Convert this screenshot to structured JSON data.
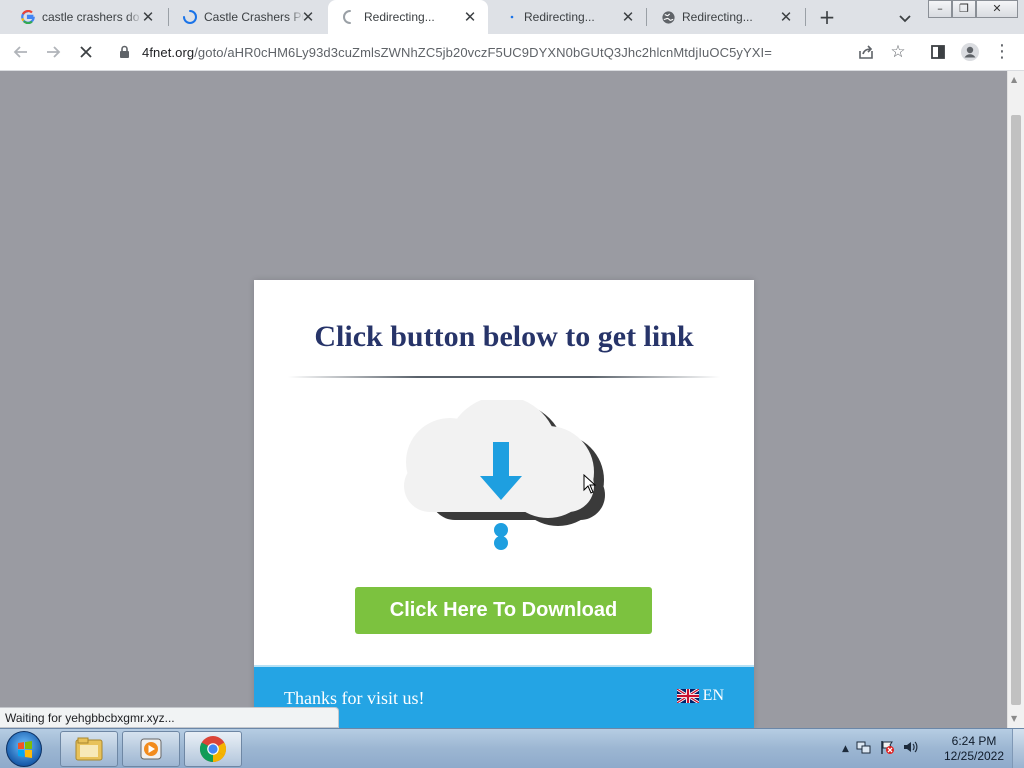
{
  "browser": {
    "tabs": [
      {
        "title": "castle crashers do",
        "favicon": "google-icon",
        "active": false
      },
      {
        "title": "Castle Crashers PC",
        "favicon": "loading-spinner-icon",
        "active": false
      },
      {
        "title": "Redirecting...",
        "favicon": "loading-spinner-icon",
        "active": true
      },
      {
        "title": "Redirecting...",
        "favicon": "dot-icon",
        "active": false
      },
      {
        "title": "Redirecting...",
        "favicon": "globe-icon",
        "active": false
      }
    ],
    "new_tab_icon": "plus-icon",
    "tab_search_icon": "chevron-down-icon",
    "window_controls": [
      "minimize-icon",
      "restore-icon",
      "close-icon"
    ],
    "address_bar": {
      "host": "4fnet.org",
      "path": "/goto/aHR0cHM6Ly93d3cuZmlsZWNhZC5jb20vczF5UC9DYXN0bGUtQ3Jhc2hlcnMtdjIuOC5yYXI="
    },
    "toolbar_icons": [
      "back-arrow-icon",
      "forward-arrow-icon",
      "stop-loading-icon",
      "lock-icon",
      "share-icon",
      "star-icon",
      "side-panel-icon",
      "profile-icon",
      "menu-icon"
    ]
  },
  "modal": {
    "title": "Click button below to get link",
    "download_button": "Click Here To Download",
    "footer_text": "Thanks for visit us!",
    "language": "EN",
    "colors": {
      "title": "#273469",
      "button": "#7cc23f",
      "footer": "#24a4e4",
      "arrow": "#1e9fe0"
    }
  },
  "status_bar": {
    "text": "Waiting for yehgbbcbxgmr.xyz..."
  },
  "taskbar": {
    "pinned": [
      "windows-explorer-icon",
      "media-player-icon",
      "chrome-icon"
    ],
    "tray_icons": [
      "show-hidden-icons-arrow",
      "network-icon",
      "action-center-flag-icon",
      "volume-icon"
    ],
    "time": "6:24 PM",
    "date": "12/25/2022"
  }
}
